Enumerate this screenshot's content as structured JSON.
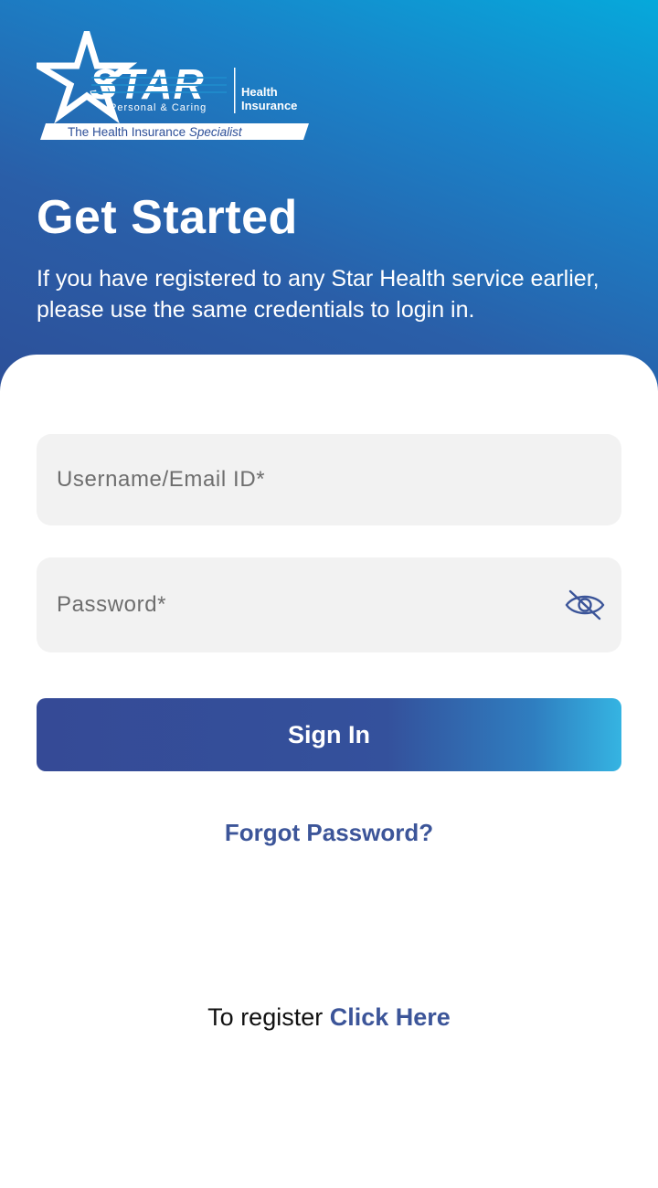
{
  "brand": {
    "name": "STAR",
    "tagline_small": "Personal & Caring",
    "product_line1": "Health",
    "product_line2": "Insurance",
    "banner_text": "The Health Insurance",
    "banner_emphasis": "Specialist"
  },
  "header": {
    "title": "Get Started",
    "subtitle": "If you have registered to any Star Health service earlier, please use the same credentials to login in."
  },
  "form": {
    "username_placeholder": "Username/Email ID*",
    "password_placeholder": "Password*",
    "password_toggle_icon": "eye-off-icon",
    "signin_label": "Sign In",
    "forgot_label": "Forgot Password?"
  },
  "register": {
    "prefix": "To register",
    "link_label": "Click Here"
  },
  "colors": {
    "header_gradient_start": "#06a9db",
    "header_gradient_end": "#2d4f98",
    "accent": "#3c5599",
    "button_start": "#354a96",
    "button_end": "#35b4e2",
    "field_bg": "#f2f2f2"
  }
}
